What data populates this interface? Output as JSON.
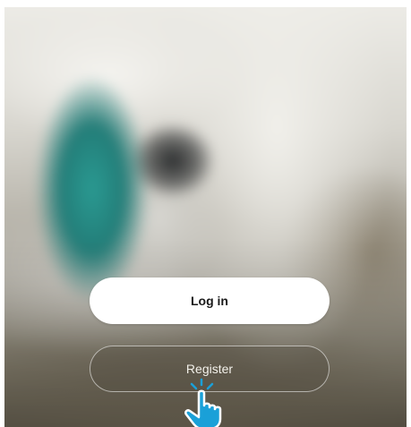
{
  "auth": {
    "login_label": "Log in",
    "register_label": "Register"
  },
  "cursor": {
    "icon": "hand-pointer-icon",
    "color": "#1aa0d8"
  },
  "colors": {
    "login_bg": "#ffffff",
    "login_text": "#1a1a1a",
    "register_text": "#f2f0ea"
  }
}
